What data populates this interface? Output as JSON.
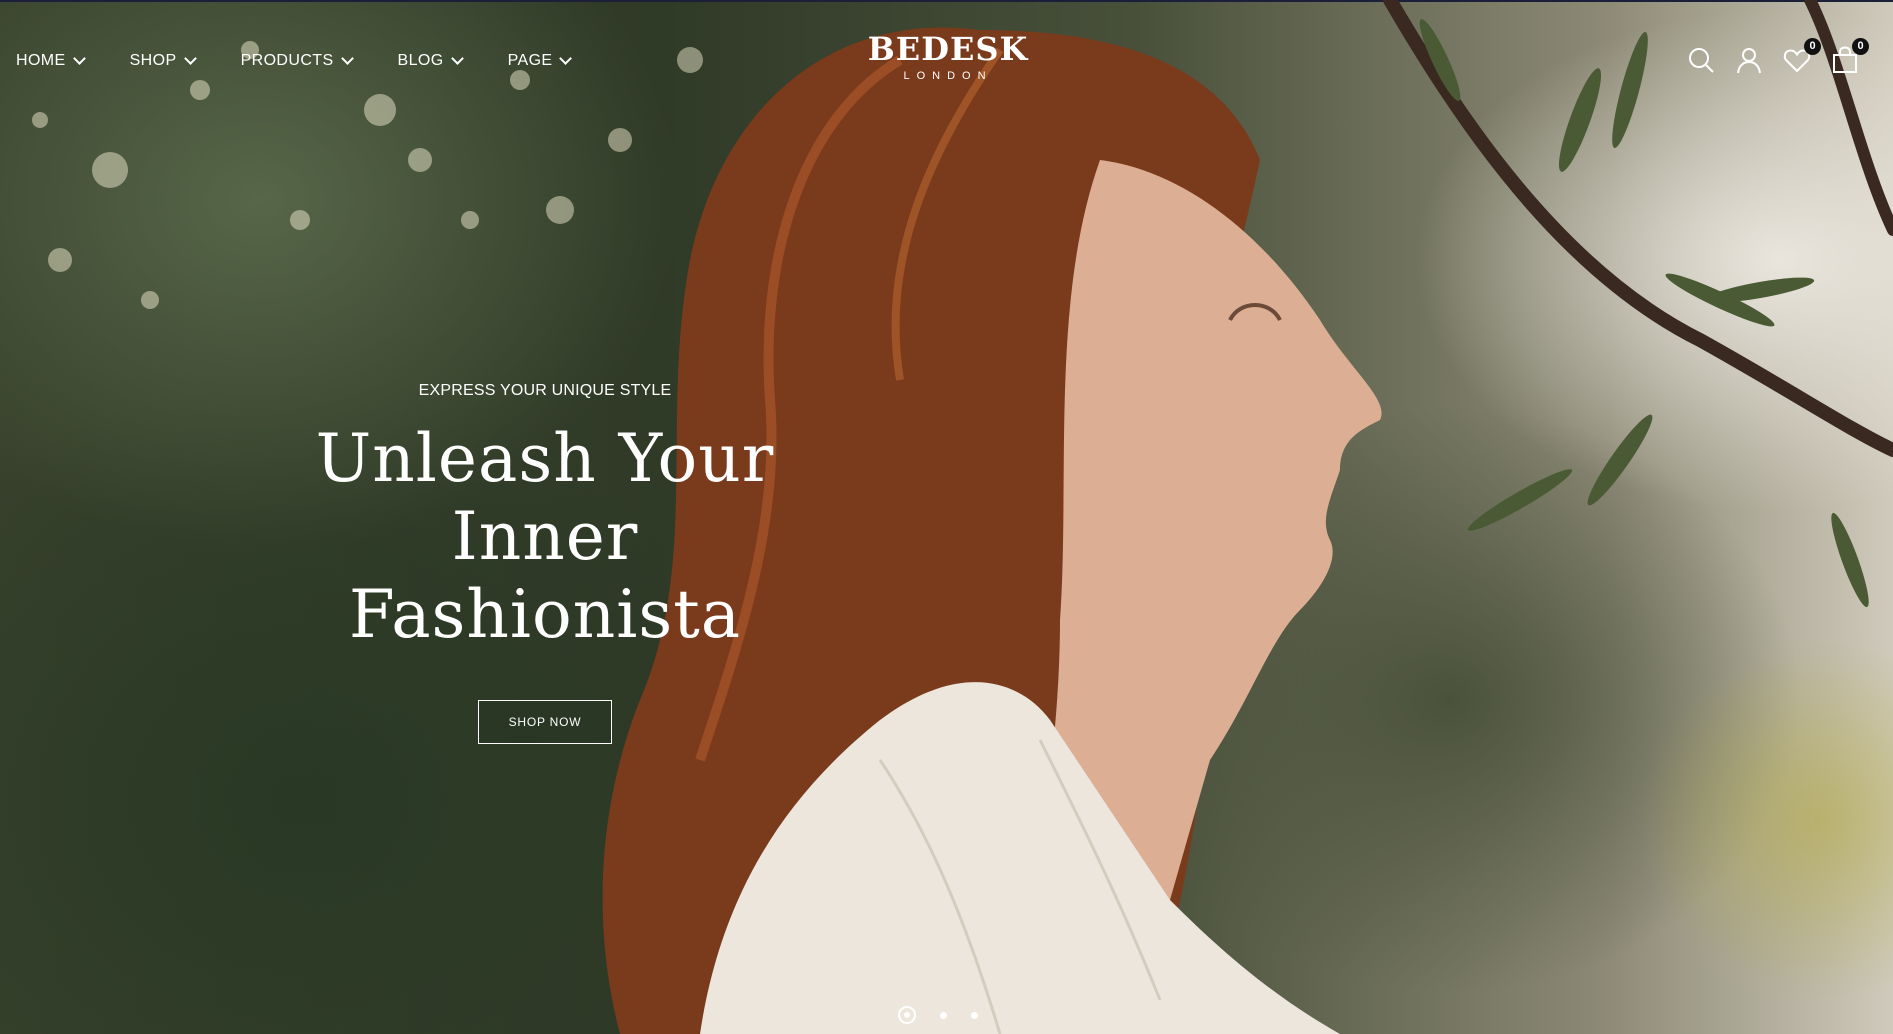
{
  "nav": {
    "items": [
      {
        "label": "HOME"
      },
      {
        "label": "SHOP"
      },
      {
        "label": "PRODUCTS"
      },
      {
        "label": "BLOG"
      },
      {
        "label": "PAGE"
      }
    ]
  },
  "logo": {
    "brand": "BEDESK",
    "sub": "LONDON"
  },
  "header_icons": {
    "search": "search-icon",
    "account": "user-icon",
    "wishlist": "heart-icon",
    "cart": "bag-icon",
    "wishlist_count": "0",
    "cart_count": "0"
  },
  "hero": {
    "eyebrow": "EXPRESS YOUR UNIQUE STYLE",
    "headline_line1": "Unleash Your",
    "headline_line2": "Inner Fashionista",
    "cta_label": "SHOP NOW"
  },
  "slider": {
    "slide_count": 3,
    "active_slide": 1
  },
  "colors": {
    "text": "#ffffff",
    "badge": "#111111"
  }
}
